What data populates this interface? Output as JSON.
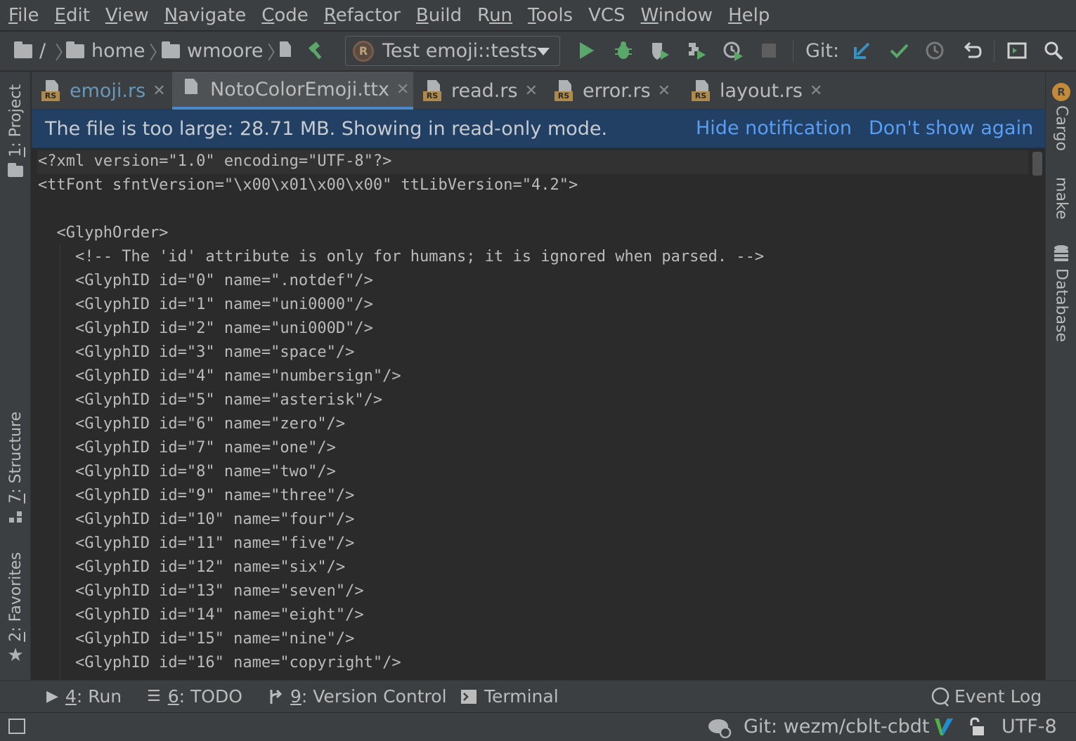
{
  "menu": {
    "items": [
      {
        "first": "F",
        "rest": "ile"
      },
      {
        "first": "E",
        "rest": "dit"
      },
      {
        "first": "V",
        "rest": "iew"
      },
      {
        "first": "N",
        "rest": "avigate"
      },
      {
        "first": "C",
        "rest": "ode"
      },
      {
        "first": "R",
        "rest": "efactor"
      },
      {
        "first": "B",
        "rest": "uild"
      },
      {
        "first": "R",
        "rest": "un",
        "prefix": "R",
        "underline_second": true
      },
      {
        "first": "T",
        "rest": "ools"
      },
      {
        "first": "",
        "rest": "VCS"
      },
      {
        "first": "W",
        "rest": "indow"
      },
      {
        "first": "H",
        "rest": "elp"
      }
    ]
  },
  "breadcrumb": {
    "root": "/",
    "home": "home",
    "user": "wmoore"
  },
  "run_config": {
    "label": "Test emoji::tests"
  },
  "git": {
    "label": "Git:"
  },
  "left_strip": {
    "project_num": "1",
    "project_label": ": Project",
    "structure_num": "7",
    "structure_label": ": Structure",
    "favorites_num": "2",
    "favorites_label": ": Favorites"
  },
  "right_strip": {
    "cargo": "Cargo",
    "make": "make",
    "database": "Database"
  },
  "tabs": [
    {
      "name": "emoji.rs"
    },
    {
      "name": "NotoColorEmoji.ttx"
    },
    {
      "name": "read.rs"
    },
    {
      "name": "error.rs"
    },
    {
      "name": "layout.rs"
    }
  ],
  "notification": {
    "message": "The file is too large: 28.71 MB. Showing in read-only mode.",
    "hide": "Hide notification",
    "dont_show": "Don't show again"
  },
  "code_lines": [
    "<?xml version=\"1.0\" encoding=\"UTF-8\"?>",
    "<ttFont sfntVersion=\"\\x00\\x01\\x00\\x00\" ttLibVersion=\"4.2\">",
    "",
    "  <GlyphOrder>",
    "    <!-- The 'id' attribute is only for humans; it is ignored when parsed. -->",
    "    <GlyphID id=\"0\" name=\".notdef\"/>",
    "    <GlyphID id=\"1\" name=\"uni0000\"/>",
    "    <GlyphID id=\"2\" name=\"uni000D\"/>",
    "    <GlyphID id=\"3\" name=\"space\"/>",
    "    <GlyphID id=\"4\" name=\"numbersign\"/>",
    "    <GlyphID id=\"5\" name=\"asterisk\"/>",
    "    <GlyphID id=\"6\" name=\"zero\"/>",
    "    <GlyphID id=\"7\" name=\"one\"/>",
    "    <GlyphID id=\"8\" name=\"two\"/>",
    "    <GlyphID id=\"9\" name=\"three\"/>",
    "    <GlyphID id=\"10\" name=\"four\"/>",
    "    <GlyphID id=\"11\" name=\"five\"/>",
    "    <GlyphID id=\"12\" name=\"six\"/>",
    "    <GlyphID id=\"13\" name=\"seven\"/>",
    "    <GlyphID id=\"14\" name=\"eight\"/>",
    "    <GlyphID id=\"15\" name=\"nine\"/>",
    "    <GlyphID id=\"16\" name=\"copyright\"/>"
  ],
  "bottom_tabs": {
    "run_num": "4",
    "run_label": ": Run",
    "todo_num": "6",
    "todo_label": ": TODO",
    "vc_num": "9",
    "vc_label": ": Version Control",
    "terminal": "Terminal",
    "event_log": "Event Log"
  },
  "status": {
    "git_branch": "Git: wezm/cblt-cbdt",
    "encoding": "UTF-8"
  },
  "colors": {
    "accent": "#4a88c7",
    "run_green": "#59a869",
    "notification_bg": "#224063",
    "link": "#589df6"
  }
}
